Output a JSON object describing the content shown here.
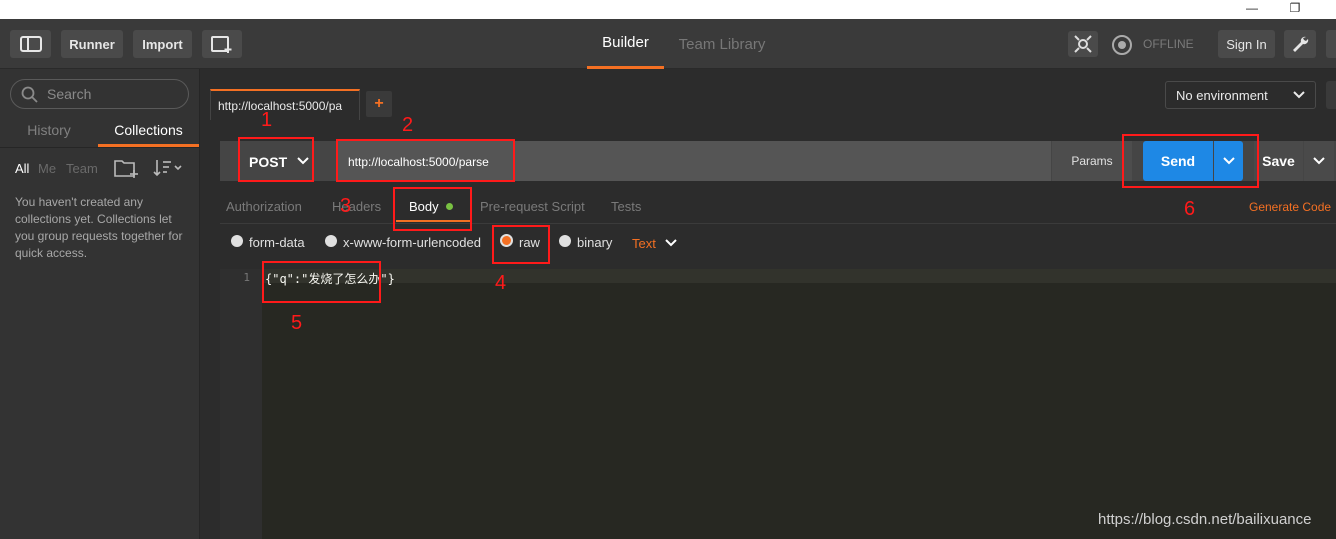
{
  "toolbar": {
    "runner": "Runner",
    "import": "Import",
    "builder": "Builder",
    "team_library": "Team Library",
    "offline": "OFFLINE",
    "sign_in": "Sign In"
  },
  "sidebar": {
    "search_placeholder": "Search",
    "tab_history": "History",
    "tab_collections": "Collections",
    "filter_all": "All",
    "filter_me": "Me",
    "filter_team": "Team",
    "empty_message": "You haven't created any collections yet. Collections let you group requests together for quick access."
  },
  "request_tab": {
    "title": "http://localhost:5000/pa",
    "add": "+"
  },
  "environment": {
    "selected": "No environment"
  },
  "request": {
    "method": "POST",
    "url": "http://localhost:5000/parse",
    "params": "Params",
    "send": "Send",
    "save": "Save",
    "generate_code": "Generate Code"
  },
  "subtabs": {
    "authorization": "Authorization",
    "headers": "Headers",
    "body": "Body",
    "prerequest": "Pre-request Script",
    "tests": "Tests"
  },
  "body_modes": {
    "form_data": "form-data",
    "urlencoded": "x-www-form-urlencoded",
    "raw": "raw",
    "binary": "binary",
    "type": "Text"
  },
  "editor": {
    "line_number": "1",
    "content": "{\"q\":\"发烧了怎么办\"}"
  },
  "annotations": [
    "1",
    "2",
    "3",
    "4",
    "5",
    "6"
  ],
  "watermark": "https://blog.csdn.net/bailixuance",
  "colors": {
    "accent": "#f47023",
    "send": "#1e88e5",
    "annotation": "#ff1a1a",
    "body_dot": "#79c142"
  }
}
